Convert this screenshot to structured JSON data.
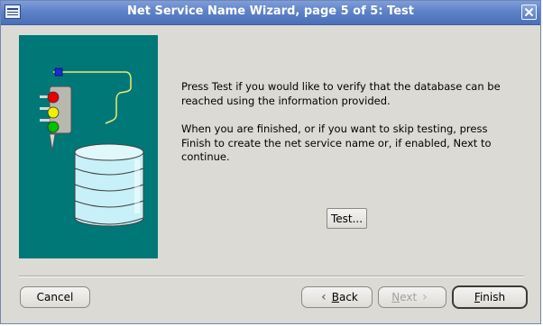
{
  "window": {
    "title": "Net Service Name Wizard, page 5 of 5: Test"
  },
  "icons": {
    "app": "window-menu-icon",
    "close": "close-icon",
    "illustration": "traffic-light-database-illustration",
    "back": "chevron-left-icon",
    "next": "chevron-right-icon"
  },
  "colors": {
    "illustration_bg": "#007878",
    "titlebar": "#5e82c8"
  },
  "content": {
    "paragraph1": "Press Test if you would like to verify that the database can be reached using the information provided.",
    "paragraph2": "When you are finished, or if you want to skip testing, press Finish to create the net service name or, if enabled, Next to continue."
  },
  "buttons": {
    "test": "Test...",
    "cancel": "Cancel",
    "back_mnemonic": "B",
    "back_rest": "ack",
    "next_mnemonic": "N",
    "next_rest": "ext",
    "finish_mnemonic": "F",
    "finish_rest": "inish",
    "chev_left": "‹",
    "chev_right": "›"
  },
  "state": {
    "next_enabled": false,
    "default_button": "Finish"
  }
}
